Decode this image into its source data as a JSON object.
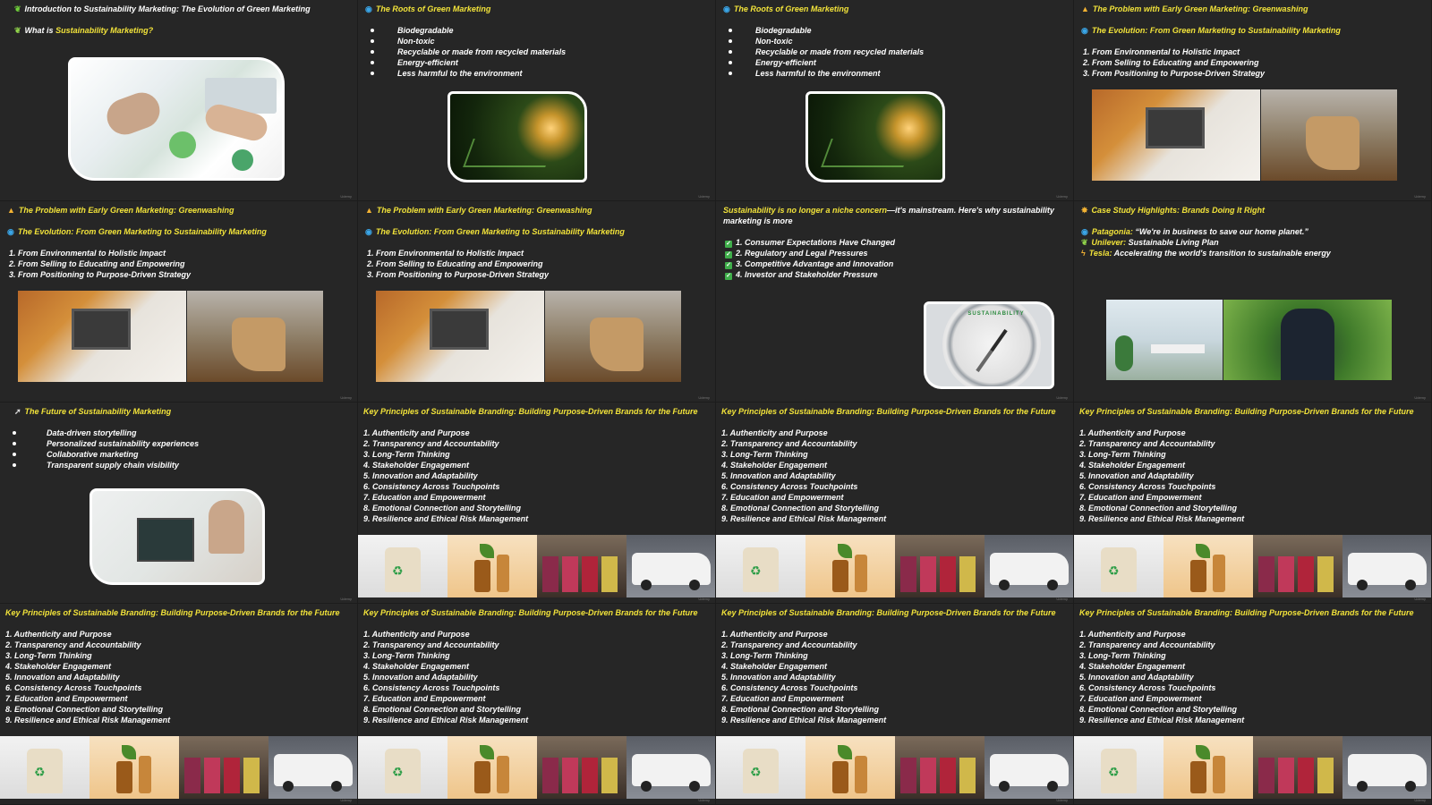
{
  "watermark": "Udemy",
  "colors": {
    "accent_yellow": "#f2e33a",
    "text": "#ffffff",
    "slide_bg": "#262626",
    "check_green": "#3fae4a"
  },
  "principles": [
    "1. Authenticity and Purpose",
    "2. Transparency and Accountability",
    "3. Long-Term Thinking",
    "4. Stakeholder Engagement",
    "5. Innovation and Adaptability",
    "6. Consistency Across Touchpoints",
    "7. Education and Empowerment",
    "8. Emotional Connection and Storytelling",
    "9. Resilience and Ethical Risk Management"
  ],
  "principles_title": "Key Principles of Sustainable Branding: Building Purpose-Driven Brands for the Future",
  "roots_items": [
    "Biodegradable",
    "Non-toxic",
    "Recyclable or made from recycled materials",
    "Energy-efficient",
    "Less harmful to the environment"
  ],
  "evolution_items": [
    "1. From Environmental to Holistic Impact",
    "2. From Selling to Educating and Empowering",
    "3. From Positioning to Purpose-Driven Strategy"
  ],
  "slides": {
    "s1": {
      "title": "Introduction to Sustainability Marketing: The Evolution of Green Marketing",
      "q_prefix": "What is ",
      "q_highlight": "Sustainability Marketing?",
      "icon": "sprout-icon"
    },
    "s2": {
      "title": "The Roots of Green Marketing",
      "icon": "globe-icon"
    },
    "s3": {
      "title": "The Roots of Green Marketing",
      "icon": "globe-icon"
    },
    "s4": {
      "title": "The Problem with Early Green Marketing: Greenwashing",
      "subtitle": "The Evolution: From Green Marketing to Sustainability Marketing"
    },
    "s5": {
      "title": "The Problem with Early Green Marketing: Greenwashing",
      "subtitle": "The Evolution: From Green Marketing to Sustainability Marketing"
    },
    "s6": {
      "title": "The Problem with Early Green Marketing: Greenwashing",
      "subtitle": "The Evolution: From Green Marketing to Sustainability Marketing"
    },
    "s7": {
      "intro_highlight": "Sustainability is no longer a niche concern",
      "intro_rest": "—it's mainstream. Here's why sustainability",
      "intro_line2": "marketing is more",
      "items": [
        "1. Consumer Expectations Have Changed",
        "2. Regulatory and Legal Pressures",
        "3. Competitive Advantage and Innovation",
        "4. Investor and Stakeholder Pressure"
      ],
      "compass_text": "SUSTAINABILITY"
    },
    "s8": {
      "title": "Case Study Highlights: Brands Doing It Right",
      "cases": [
        {
          "brand": "Patagonia:",
          "text": " “We're in business to save our home planet.”"
        },
        {
          "brand": "Unilever:",
          "text": " Sustainable Living Plan"
        },
        {
          "brand": "Tesla:",
          "text": " Accelerating the world's transition to sustainable energy"
        }
      ]
    },
    "s9": {
      "title": "The Future of Sustainability Marketing",
      "items": [
        "Data-driven storytelling",
        "Personalized sustainability experiences",
        "Collaborative marketing",
        "Transparent supply chain visibility"
      ]
    }
  }
}
